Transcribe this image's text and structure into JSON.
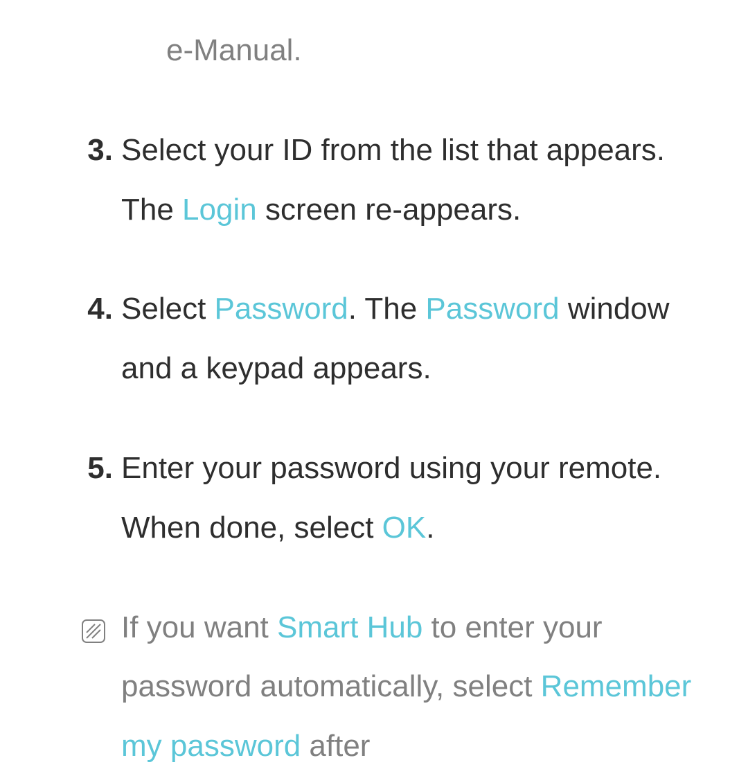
{
  "topLine": "e-Manual.",
  "step3": {
    "num": "3.",
    "t1": "Select your ID from the list that appears. The ",
    "login": "Login",
    "t2": " screen re-appears."
  },
  "step4": {
    "num": "4.",
    "t1": "Select ",
    "password1": "Password",
    "t2": ". The ",
    "password2": "Password",
    "t3": " window and a keypad appears."
  },
  "step5": {
    "num": "5.",
    "t1": "Enter your password using your remote. When done, select ",
    "ok": "OK",
    "t2": "."
  },
  "note": {
    "t1": "If you want ",
    "smartHub": "Smart Hub",
    "t2": " to enter your password automatically, select ",
    "remember": "Remember my password",
    "t3": " after"
  }
}
